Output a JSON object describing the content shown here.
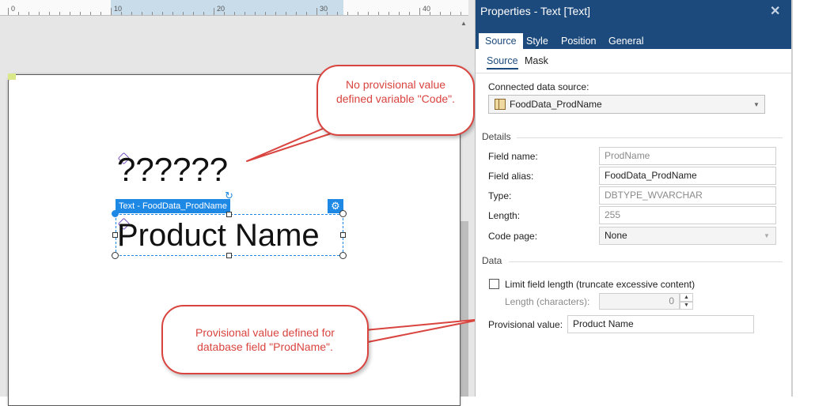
{
  "ruler": {
    "labels": [
      "0",
      "10",
      "20",
      "30",
      "40"
    ]
  },
  "canvas": {
    "placeholder_text": "??????",
    "selection_label": "Text - FoodData_ProdName",
    "selected_text": "Product Name"
  },
  "callouts": {
    "top": "No provisional value defined variable \"Code\".",
    "bottom": "Provisional value defined for database field \"ProdName\"."
  },
  "panel": {
    "title": "Properties - Text [Text]",
    "tabs": [
      "Source",
      "Style",
      "Position",
      "General"
    ],
    "active_tab": "Source",
    "subtabs": [
      "Source",
      "Mask"
    ],
    "connected_source_label": "Connected data source:",
    "connected_source_value": "FoodData_ProdName",
    "details_title": "Details",
    "details": {
      "field_name_label": "Field name:",
      "field_name_value": "ProdName",
      "field_alias_label": "Field alias:",
      "field_alias_value": "FoodData_ProdName",
      "type_label": "Type:",
      "type_value": "DBTYPE_WVARCHAR",
      "length_label": "Length:",
      "length_value": "255",
      "code_page_label": "Code page:",
      "code_page_value": "None"
    },
    "data_title": "Data",
    "data": {
      "limit_label": "Limit field length (truncate excessive content)",
      "length_chars_label": "Length (characters):",
      "length_chars_value": "0",
      "provisional_label": "Provisional value:",
      "provisional_value": "Product Name"
    }
  },
  "colors": {
    "header": "#1d4a7c",
    "accent": "#1e88e5",
    "callout": "#d9443f"
  }
}
